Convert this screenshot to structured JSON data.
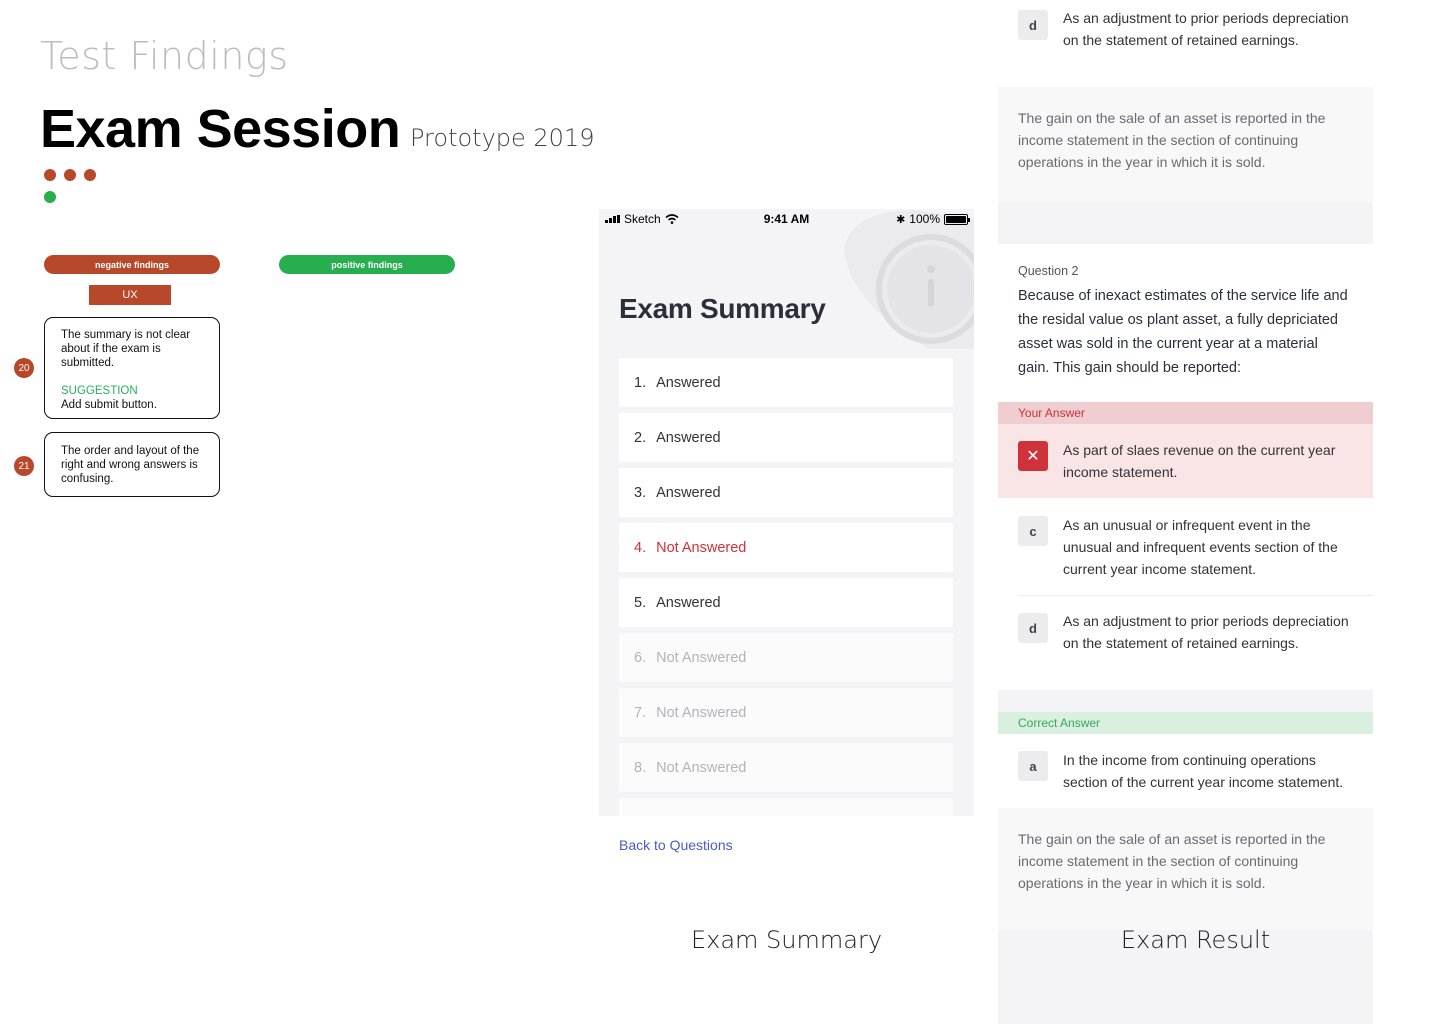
{
  "header": {
    "kicker": "Test Findings",
    "title": "Exam Session",
    "subtitle": "Prototype 2019"
  },
  "legend": {
    "negative": "negative findings",
    "positive": "positive findings",
    "category": "UX"
  },
  "colors": {
    "negative": "#b7482a",
    "positive": "#27ae4f",
    "wrong": "#d0323c",
    "link": "#4b5bc4"
  },
  "findings": [
    {
      "number": "20",
      "text": "The summary is not clear about if the exam is submitted.",
      "suggestion_label": "SUGGESTION",
      "suggestion": "Add submit button."
    },
    {
      "number": "21",
      "text": "The order and layout of the right and wrong answers is confusing."
    }
  ],
  "phone": {
    "status": {
      "carrier": "Sketch",
      "time": "9:41 AM",
      "battery": "100%"
    },
    "title": "Exam Summary",
    "items": [
      {
        "num": "1.",
        "label": "Answered",
        "state": "answered"
      },
      {
        "num": "2.",
        "label": "Answered",
        "state": "answered"
      },
      {
        "num": "3.",
        "label": "Answered",
        "state": "answered"
      },
      {
        "num": "4.",
        "label": "Not Answered",
        "state": "current-unanswered"
      },
      {
        "num": "5.",
        "label": "Answered",
        "state": "answered"
      },
      {
        "num": "6.",
        "label": "Not Answered",
        "state": "unanswered"
      },
      {
        "num": "7.",
        "label": "Not Answered",
        "state": "unanswered"
      },
      {
        "num": "8.",
        "label": "Not Answered",
        "state": "unanswered"
      }
    ],
    "back_link": "Back to Questions"
  },
  "captions": {
    "summary": "Exam Summary",
    "result": "Exam Result"
  },
  "result": {
    "top_option": {
      "letter": "d",
      "text": "As an adjustment to prior periods depreciation on the statement of retained earnings."
    },
    "top_explanation": "The gain on the sale of an asset is reported in the income statement in the section of continuing operations in the year in which it is sold.",
    "question_label": "Question 2",
    "question_text": "Because of inexact estimates of the service life and the residal value os plant asset, a fully depriciated asset was sold in the current year at a material gain. This gain should be reported:",
    "your_answer_label": "Your Answer",
    "your_answer_text": "As part of slaes revenue on the current year income statement.",
    "options": [
      {
        "letter": "c",
        "text": "As an unusual or infrequent event in the unusual and infrequent events section of the current year income statement."
      },
      {
        "letter": "d",
        "text": "As an adjustment to prior periods depreciation on the statement of retained earnings."
      }
    ],
    "correct_answer_label": "Correct Answer",
    "correct_option": {
      "letter": "a",
      "text": "In the income from continuing operations section of the current year income statement."
    },
    "explanation": "The gain on the sale of an asset is reported in the income statement in the section of continuing operations in the year in which it is sold."
  }
}
